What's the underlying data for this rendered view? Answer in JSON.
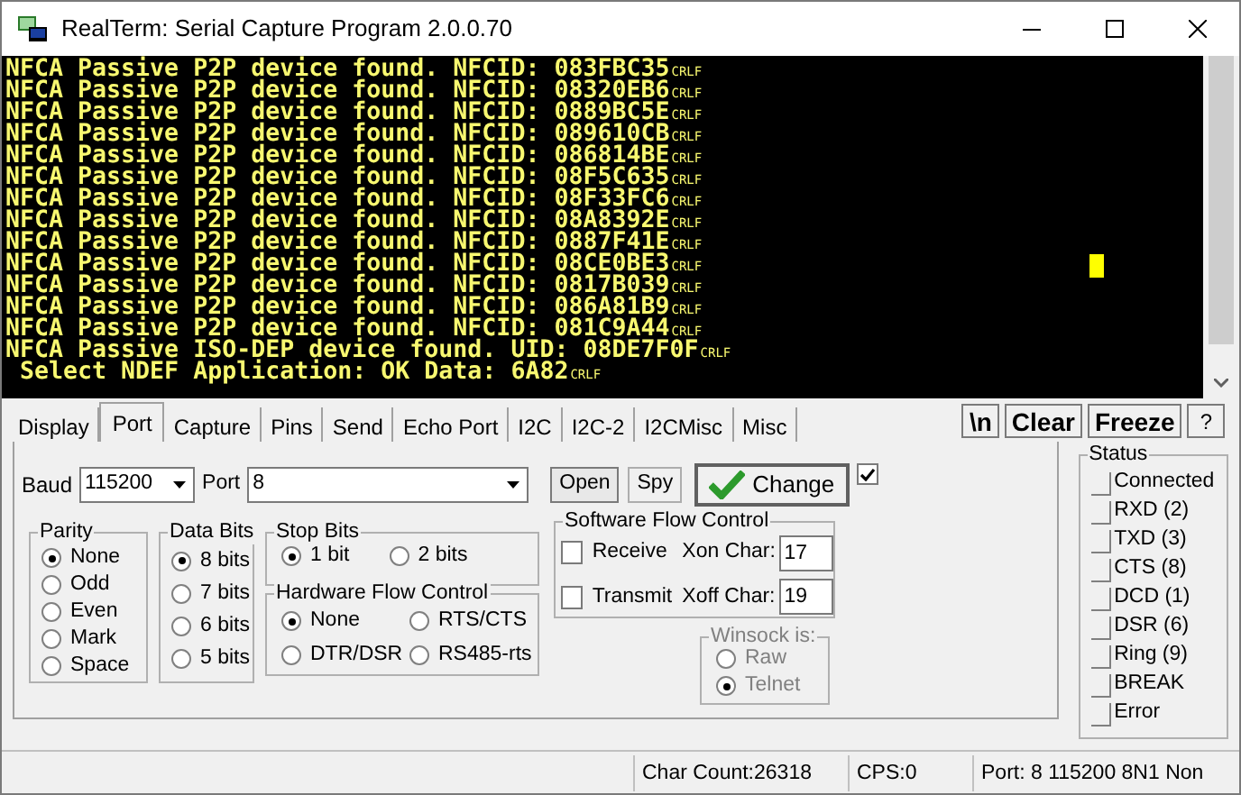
{
  "window": {
    "title": "RealTerm: Serial Capture Program 2.0.0.70"
  },
  "terminal": {
    "lines": [
      {
        "text": "NFCA Passive P2P device found. NFCID: 083FBC35",
        "end": "CRLF"
      },
      {
        "text": "NFCA Passive P2P device found. NFCID: 08320EB6",
        "end": "CRLF"
      },
      {
        "text": "NFCA Passive P2P device found. NFCID: 0889BC5E",
        "end": "CRLF"
      },
      {
        "text": "NFCA Passive P2P device found. NFCID: 089610CB",
        "end": "CRLF"
      },
      {
        "text": "NFCA Passive P2P device found. NFCID: 086814BE",
        "end": "CRLF"
      },
      {
        "text": "NFCA Passive P2P device found. NFCID: 08F5C635",
        "end": "CRLF"
      },
      {
        "text": "NFCA Passive P2P device found. NFCID: 08F33FC6",
        "end": "CRLF"
      },
      {
        "text": "NFCA Passive P2P device found. NFCID: 08A8392E",
        "end": "CRLF"
      },
      {
        "text": "NFCA Passive P2P device found. NFCID: 0887F41E",
        "end": "CRLF"
      },
      {
        "text": "NFCA Passive P2P device found. NFCID: 08CE0BE3",
        "end": "CRLF"
      },
      {
        "text": "NFCA Passive P2P device found. NFCID: 0817B039",
        "end": "CRLF"
      },
      {
        "text": "NFCA Passive P2P device found. NFCID: 086A81B9",
        "end": "CRLF"
      },
      {
        "text": "NFCA Passive P2P device found. NFCID: 081C9A44",
        "end": "CRLF"
      },
      {
        "text": "NFCA Passive ISO-DEP device found. UID: 08DE7F0F",
        "end": "CRLF"
      },
      {
        "text": " Select NDEF Application: OK Data: 6A82",
        "end": "CRLF"
      }
    ]
  },
  "tabs": [
    {
      "label": "Display",
      "selected": false
    },
    {
      "label": "Port",
      "selected": true
    },
    {
      "label": "Capture",
      "selected": false
    },
    {
      "label": "Pins",
      "selected": false
    },
    {
      "label": "Send",
      "selected": false
    },
    {
      "label": "Echo Port",
      "selected": false
    },
    {
      "label": "I2C",
      "selected": false
    },
    {
      "label": "I2C-2",
      "selected": false
    },
    {
      "label": "I2CMisc",
      "selected": false
    },
    {
      "label": "Misc",
      "selected": false
    }
  ],
  "toolbar_buttons": [
    "\\n",
    "Clear",
    "Freeze",
    "?"
  ],
  "port": {
    "baud_label": "Baud",
    "baud": "115200",
    "port_label": "Port",
    "port": "8",
    "open": "Open",
    "spy": "Spy",
    "change": "Change",
    "change_checked": true
  },
  "parity": {
    "title": "Parity",
    "options": [
      {
        "label": "None",
        "selected": true
      },
      {
        "label": "Odd",
        "selected": false
      },
      {
        "label": "Even",
        "selected": false
      },
      {
        "label": "Mark",
        "selected": false
      },
      {
        "label": "Space",
        "selected": false
      }
    ]
  },
  "data_bits": {
    "title": "Data Bits",
    "options": [
      {
        "label": "8 bits",
        "selected": true
      },
      {
        "label": "7 bits",
        "selected": false
      },
      {
        "label": "6 bits",
        "selected": false
      },
      {
        "label": "5 bits",
        "selected": false
      }
    ]
  },
  "stop_bits": {
    "title": "Stop Bits",
    "options": [
      {
        "label": "1 bit",
        "selected": true
      },
      {
        "label": "2 bits",
        "selected": false
      }
    ]
  },
  "hardware_flow": {
    "title": "Hardware Flow Control",
    "options": [
      {
        "label": "None",
        "selected": true
      },
      {
        "label": "RTS/CTS",
        "selected": false
      },
      {
        "label": "DTR/DSR",
        "selected": false
      },
      {
        "label": "RS485-rts",
        "selected": false
      }
    ]
  },
  "software_flow": {
    "title": "Software Flow Control",
    "rows": [
      {
        "label": "Receive",
        "checked": false,
        "char_label": "Xon Char:",
        "value": "17"
      },
      {
        "label": "Transmit",
        "checked": false,
        "char_label": "Xoff Char:",
        "value": "19"
      }
    ]
  },
  "winsock": {
    "title": "Winsock is:",
    "options": [
      {
        "label": "Raw",
        "selected": false
      },
      {
        "label": "Telnet",
        "selected": true
      }
    ]
  },
  "status": {
    "title": "Status",
    "items": [
      {
        "label": "Connected",
        "on": false
      },
      {
        "label": "RXD (2)",
        "on": false
      },
      {
        "label": "TXD (3)",
        "on": false
      },
      {
        "label": "CTS (8)",
        "on": false
      },
      {
        "label": "DCD (1)",
        "on": false
      },
      {
        "label": "DSR (6)",
        "on": false
      },
      {
        "label": "Ring (9)",
        "on": false
      },
      {
        "label": "BREAK",
        "on": false
      },
      {
        "label": "Error",
        "on": false
      }
    ]
  },
  "status_bar": [
    "Char Count:26318",
    "CPS:0",
    "Port: 8 115200 8N1 Non"
  ]
}
